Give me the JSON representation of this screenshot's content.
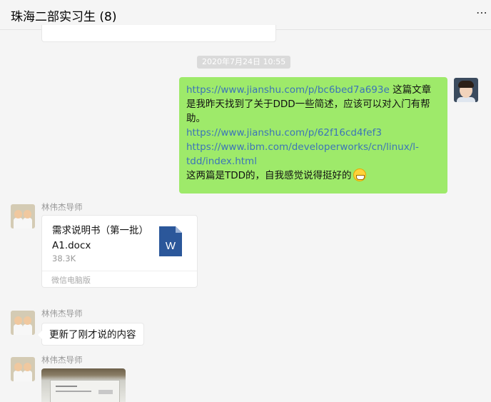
{
  "header": {
    "title": "珠海二部实习生 (8)",
    "more_icon": "⋯"
  },
  "timestamp": "2020年7月24日 10:55",
  "my_message": {
    "lines": [
      {
        "link": "https://www.jianshu.com/p/bc6bed7a693e",
        "text": " 这篇文章是我昨天找到了关于DDD一些简述，应该可以对入门有帮助。"
      },
      {
        "link": "https://www.jianshu.com/p/62f16cd4fef3",
        "text": ""
      },
      {
        "link": "https://www.ibm.com/developerworks/cn/linux/l-tdd/index.html",
        "text": ""
      },
      {
        "link": "",
        "text": "这两篇是TDD的，自我感觉说得挺好的"
      }
    ],
    "emoji": "grin-emoji"
  },
  "messages": [
    {
      "sender": "林伟杰导师",
      "file": {
        "name": "需求说明书（第一批）A1.docx",
        "size": "38.3K",
        "source": "微信电脑版",
        "icon": "word-doc-icon"
      }
    },
    {
      "sender": "林伟杰导师",
      "text": "更新了刚才说的内容"
    },
    {
      "sender": "林伟杰导师",
      "image": "photo-of-screen"
    }
  ],
  "colors": {
    "my_bubble": "#9eea6a",
    "link": "#3c74b8",
    "background": "#f5f5f5",
    "word_blue": "#2b579a"
  }
}
